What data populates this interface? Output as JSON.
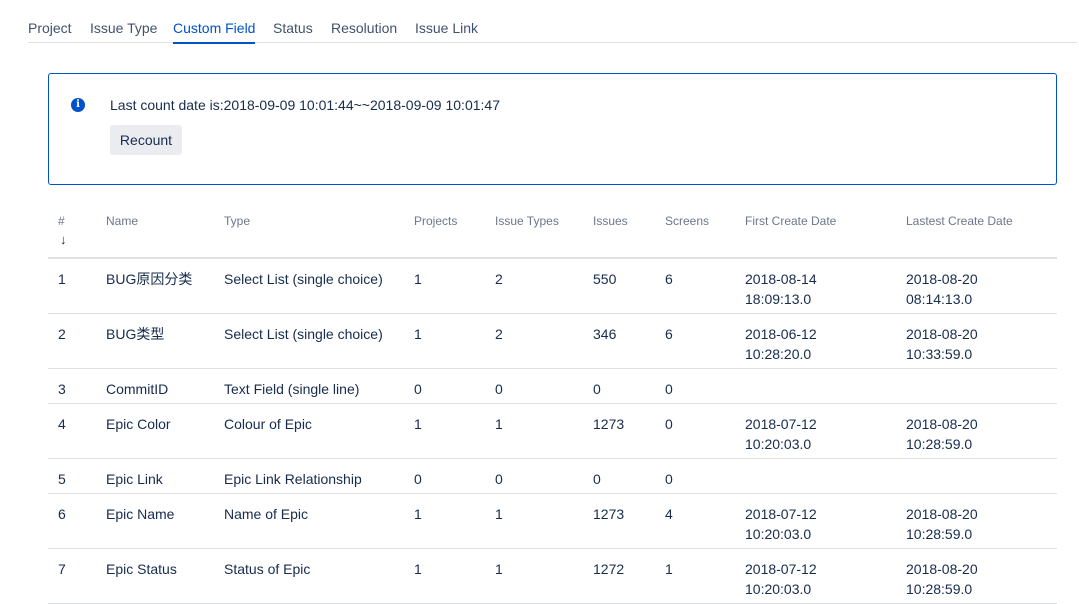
{
  "tabs": [
    {
      "label": "Project",
      "active": false
    },
    {
      "label": "Issue Type",
      "active": false
    },
    {
      "label": "Custom Field",
      "active": true
    },
    {
      "label": "Status",
      "active": false
    },
    {
      "label": "Resolution",
      "active": false
    },
    {
      "label": "Issue Link",
      "active": false
    }
  ],
  "info": {
    "icon": "info-icon",
    "text": "Last count date is:2018-09-09 10:01:44~~2018-09-09 10:01:47",
    "button_label": "Recount"
  },
  "table": {
    "headers": [
      "#",
      "Name",
      "Type",
      "Projects",
      "Issue Types",
      "Issues",
      "Screens",
      "First Create Date",
      "Lastest Create Date"
    ],
    "sort_icon": "sort-down-arrow-icon",
    "rows": [
      {
        "num": "1",
        "name": "BUG原因分类",
        "type": "Select List (single choice)",
        "projects": "1",
        "issue_types": "2",
        "issues": "550",
        "screens": "6",
        "first_date": "2018-08-14",
        "first_time": "18:09:13.0",
        "last_date": "2018-08-20",
        "last_time": "08:14:13.0"
      },
      {
        "num": "2",
        "name": "BUG类型",
        "type": "Select List (single choice)",
        "projects": "1",
        "issue_types": "2",
        "issues": "346",
        "screens": "6",
        "first_date": "2018-06-12",
        "first_time": "10:28:20.0",
        "last_date": "2018-08-20",
        "last_time": "10:33:59.0"
      },
      {
        "num": "3",
        "name": "CommitID",
        "type": "Text Field (single line)",
        "projects": "0",
        "issue_types": "0",
        "issues": "0",
        "screens": "0",
        "first_date": "",
        "first_time": "",
        "last_date": "",
        "last_time": ""
      },
      {
        "num": "4",
        "name": "Epic Color",
        "type": "Colour of Epic",
        "projects": "1",
        "issue_types": "1",
        "issues": "1273",
        "screens": "0",
        "first_date": "2018-07-12",
        "first_time": "10:20:03.0",
        "last_date": "2018-08-20",
        "last_time": "10:28:59.0"
      },
      {
        "num": "5",
        "name": "Epic Link",
        "type": "Epic Link Relationship",
        "projects": "0",
        "issue_types": "0",
        "issues": "0",
        "screens": "0",
        "first_date": "",
        "first_time": "",
        "last_date": "",
        "last_time": ""
      },
      {
        "num": "6",
        "name": "Epic Name",
        "type": "Name of Epic",
        "projects": "1",
        "issue_types": "1",
        "issues": "1273",
        "screens": "4",
        "first_date": "2018-07-12",
        "first_time": "10:20:03.0",
        "last_date": "2018-08-20",
        "last_time": "10:28:59.0"
      },
      {
        "num": "7",
        "name": "Epic Status",
        "type": "Status of Epic",
        "projects": "1",
        "issue_types": "1",
        "issues": "1272",
        "screens": "1",
        "first_date": "2018-07-12",
        "first_time": "10:20:03.0",
        "last_date": "2018-08-20",
        "last_time": "10:28:59.0"
      }
    ]
  }
}
